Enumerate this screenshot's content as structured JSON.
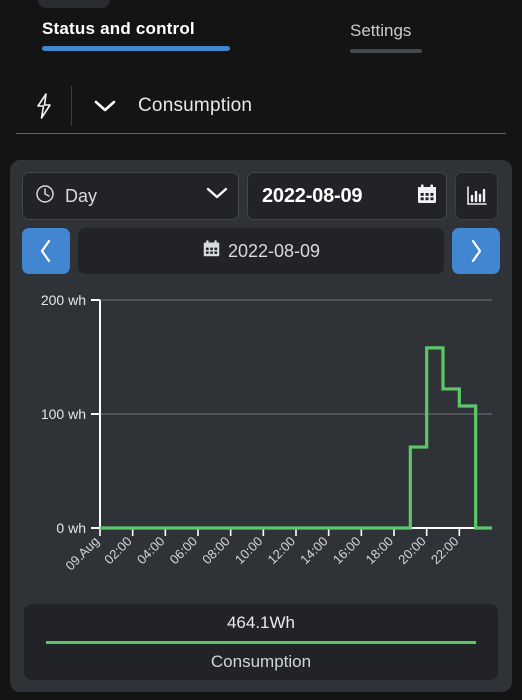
{
  "top_chip": {
    "name": "partial-pill"
  },
  "tabs": [
    {
      "label": "Status and control",
      "active": true
    },
    {
      "label": "Settings",
      "active": false
    }
  ],
  "entity_header": {
    "bolt_icon": "lightning-bolt-icon",
    "chevron_icon": "chevron-down-icon",
    "name": "Consumption"
  },
  "controls": {
    "period_select": {
      "icon": "clock-icon",
      "value": "Day",
      "chevron_icon": "chevron-down-icon"
    },
    "date_field": {
      "value": "2022-08-09",
      "icon": "calendar-icon"
    },
    "chart_type_button": {
      "icon": "bar-chart-icon"
    },
    "prev_button": {
      "icon": "chevron-left-icon"
    },
    "next_button": {
      "icon": "chevron-right-icon"
    },
    "date_display": {
      "icon": "calendar-icon",
      "value": "2022-08-09"
    }
  },
  "legend": {
    "total": "464.1Wh",
    "series_name": "Consumption",
    "color": "#5cc76a"
  },
  "colors": {
    "accent_blue": "#4285d0",
    "series_green": "#5cc76a",
    "card_bg": "#2f3338",
    "control_bg": "#212326",
    "page_bg": "#141414"
  },
  "chart_data": {
    "type": "line",
    "subtype": "step",
    "title": "",
    "xlabel": "",
    "ylabel": "",
    "ylim": [
      0,
      200
    ],
    "yticks": [
      0,
      100,
      200
    ],
    "ytick_labels": [
      "0 wh",
      "100 wh",
      "200 wh"
    ],
    "xtick_labels": [
      "09.Aug",
      "02:00",
      "04:00",
      "06:00",
      "08:00",
      "10:00",
      "12:00",
      "14:00",
      "16:00",
      "18:00",
      "20:00",
      "22:00"
    ],
    "grid": true,
    "legend_position": "bottom",
    "series": [
      {
        "name": "Consumption",
        "color": "#5cc76a",
        "unit": "wh",
        "x": [
          "00:00",
          "01:00",
          "02:00",
          "03:00",
          "04:00",
          "05:00",
          "06:00",
          "07:00",
          "08:00",
          "09:00",
          "10:00",
          "11:00",
          "12:00",
          "13:00",
          "14:00",
          "15:00",
          "16:00",
          "17:00",
          "18:00",
          "19:00",
          "20:00",
          "21:00",
          "22:00",
          "23:00"
        ],
        "values": [
          0,
          0,
          0,
          0,
          0,
          0,
          0,
          0,
          0,
          0,
          0,
          0,
          0,
          0,
          0,
          0,
          0,
          0,
          0,
          71,
          158,
          122,
          107,
          0
        ]
      }
    ],
    "total": "464.1Wh"
  }
}
